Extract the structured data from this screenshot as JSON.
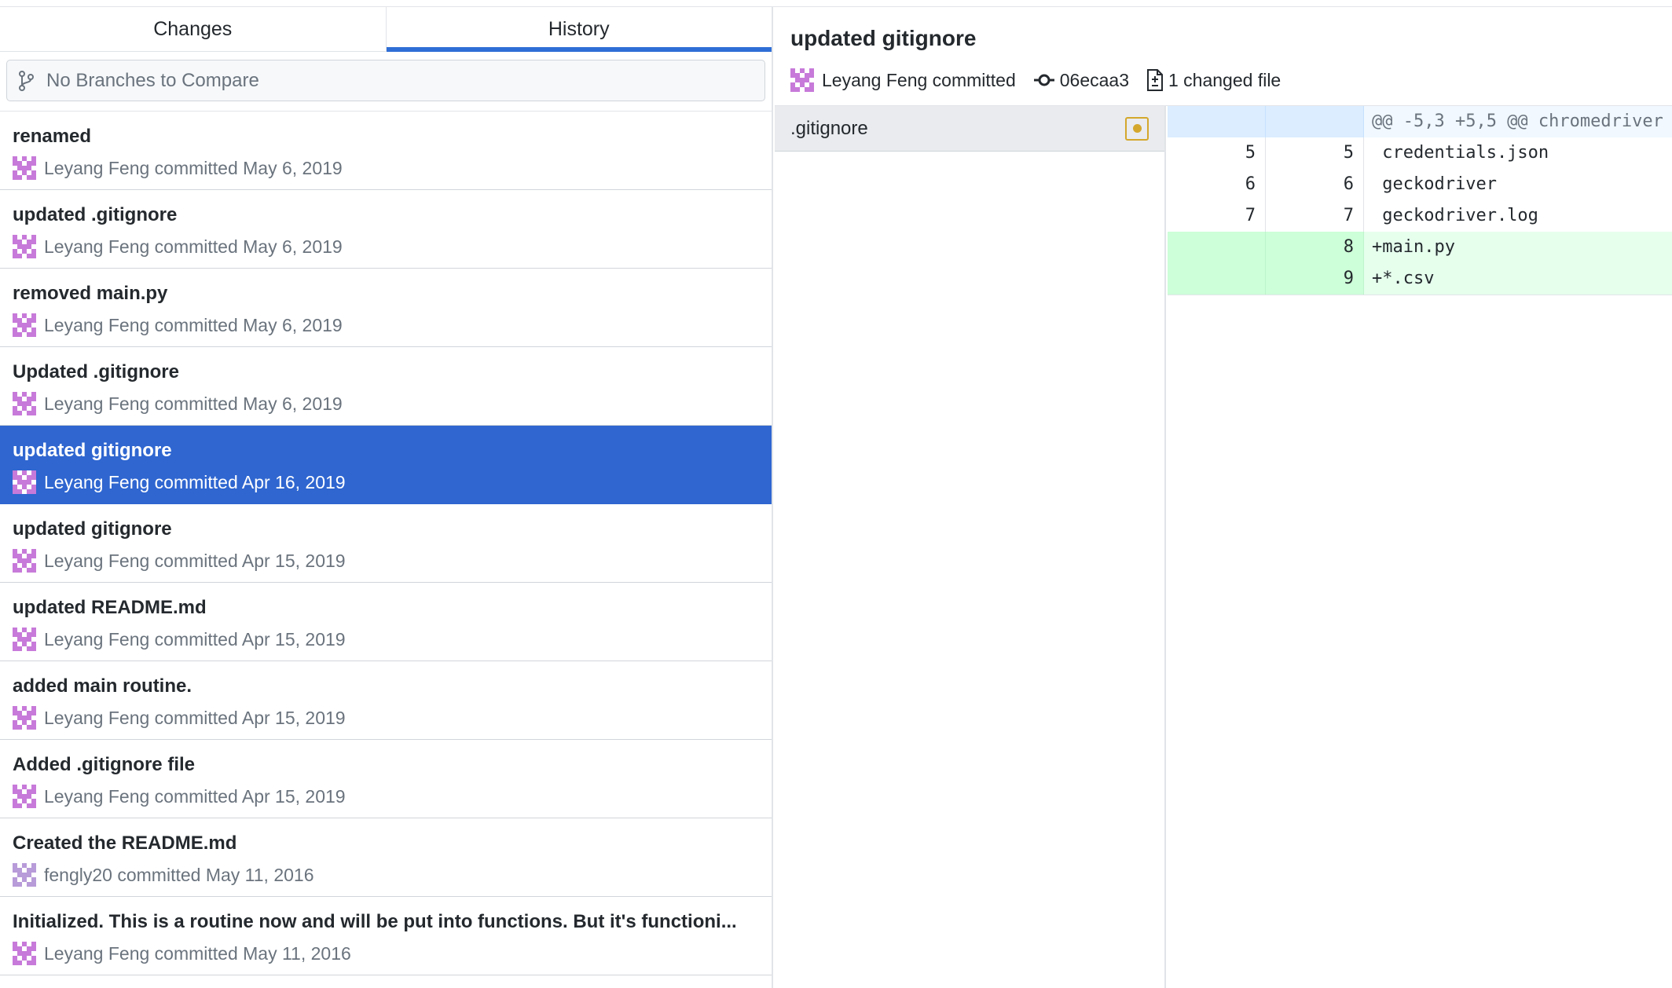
{
  "tabs": [
    {
      "label": "Changes",
      "selected": false
    },
    {
      "label": "History",
      "selected": true
    }
  ],
  "compare": {
    "icon": "git-branch-icon",
    "placeholder": "No Branches to Compare"
  },
  "commits": [
    {
      "title": "renamed",
      "meta": "Leyang Feng committed May 6, 2019"
    },
    {
      "title": "updated .gitignore",
      "meta": "Leyang Feng committed May 6, 2019"
    },
    {
      "title": "removed main.py",
      "meta": "Leyang Feng committed May 6, 2019"
    },
    {
      "title": "Updated .gitignore",
      "meta": "Leyang Feng committed May 6, 2019"
    },
    {
      "title": "updated gitignore",
      "meta": "Leyang Feng committed Apr 16, 2019",
      "selected": true
    },
    {
      "title": "updated gitignore",
      "meta": "Leyang Feng committed Apr 15, 2019"
    },
    {
      "title": "updated README.md",
      "meta": "Leyang Feng committed Apr 15, 2019"
    },
    {
      "title": "added main routine.",
      "meta": "Leyang Feng committed Apr 15, 2019"
    },
    {
      "title": "Added .gitignore file",
      "meta": "Leyang Feng committed Apr 15, 2019"
    },
    {
      "title": "Created the README.md",
      "meta": "fengly20 committed May 11, 2016"
    },
    {
      "title": "Initialized. This is a routine now and will be put into functions. But it's functioni...",
      "meta": "Leyang Feng committed May 11, 2016"
    }
  ],
  "summary": {
    "title": "updated gitignore",
    "author": "Leyang Feng committed",
    "sha": "06ecaa3",
    "files_changed": "1 changed file"
  },
  "files": [
    {
      "name": ".gitignore",
      "status": "modified"
    }
  ],
  "diff": {
    "hunk": "@@ -5,3 +5,5 @@ chromedriver",
    "lines": [
      {
        "old": "5",
        "new": "5",
        "text": " credentials.json",
        "type": "context"
      },
      {
        "old": "6",
        "new": "6",
        "text": " geckodriver",
        "type": "context"
      },
      {
        "old": "7",
        "new": "7",
        "text": " geckodriver.log",
        "type": "context"
      },
      {
        "old": "",
        "new": "8",
        "text": "+main.py",
        "type": "add"
      },
      {
        "old": "",
        "new": "9",
        "text": "+*.csv",
        "type": "add"
      }
    ]
  },
  "colors": {
    "accent": "#2f66d0",
    "added_bg": "#e6ffed",
    "modified": "#d4a72c",
    "avatar": "#c77ad9"
  }
}
